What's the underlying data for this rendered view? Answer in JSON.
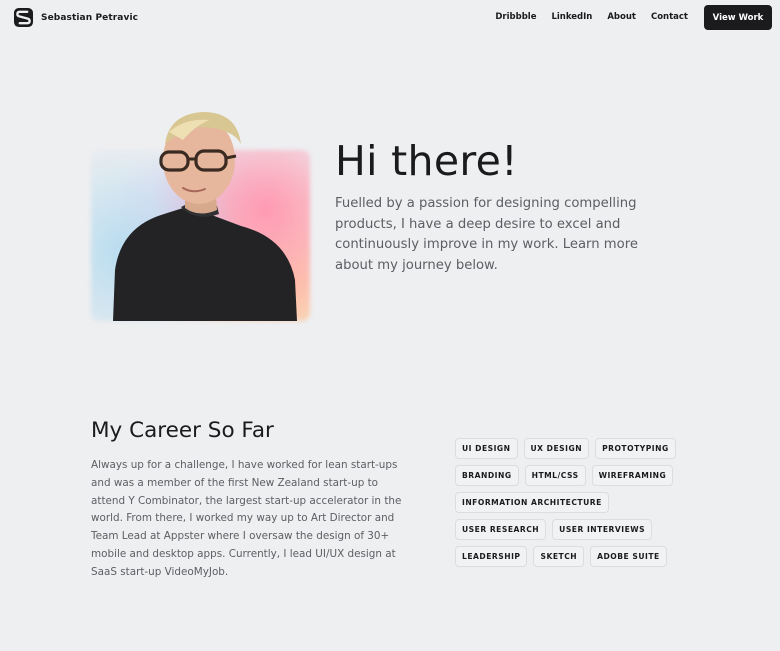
{
  "nav": {
    "brand_name": "Sebastian Petravic",
    "brand_icon": "s-logo-icon",
    "links": [
      "Dribbble",
      "LinkedIn",
      "About",
      "Contact"
    ],
    "cta_label": "View Work"
  },
  "hero": {
    "title": "Hi there!",
    "text": "Fuelled by a passion for designing compelling products, I have a deep desire to excel and continuously improve in my work. Learn more about my journey below.",
    "photo": "portrait-photo"
  },
  "career": {
    "title": "My Career So Far",
    "text": "Always up for a challenge, I have worked for lean start-ups and was a member of the first New Zealand start-up to attend Y Combinator, the largest start-up accelerator in the world. From there, I worked my way up to Art Director and Team Lead at Appster where I oversaw the design of 30+ mobile and desktop apps. Currently, I lead UI/UX design at SaaS start-up VideoMyJob.",
    "skills": [
      [
        "UI DESIGN",
        "UX DESIGN",
        "PROTOTYPING"
      ],
      [
        "BRANDING",
        "HTML/CSS",
        "WIREFRAMING"
      ],
      [
        "INFORMATION ARCHITECTURE"
      ],
      [
        "USER RESEARCH",
        "USER INTERVIEWS"
      ],
      [
        "LEADERSHIP",
        "SKETCH",
        "ADOBE SUITE"
      ]
    ]
  },
  "colors": {
    "background": "#eeeff1",
    "text": "#1b1b1d",
    "muted": "#5d5e63",
    "button": "#1b1b1d"
  }
}
